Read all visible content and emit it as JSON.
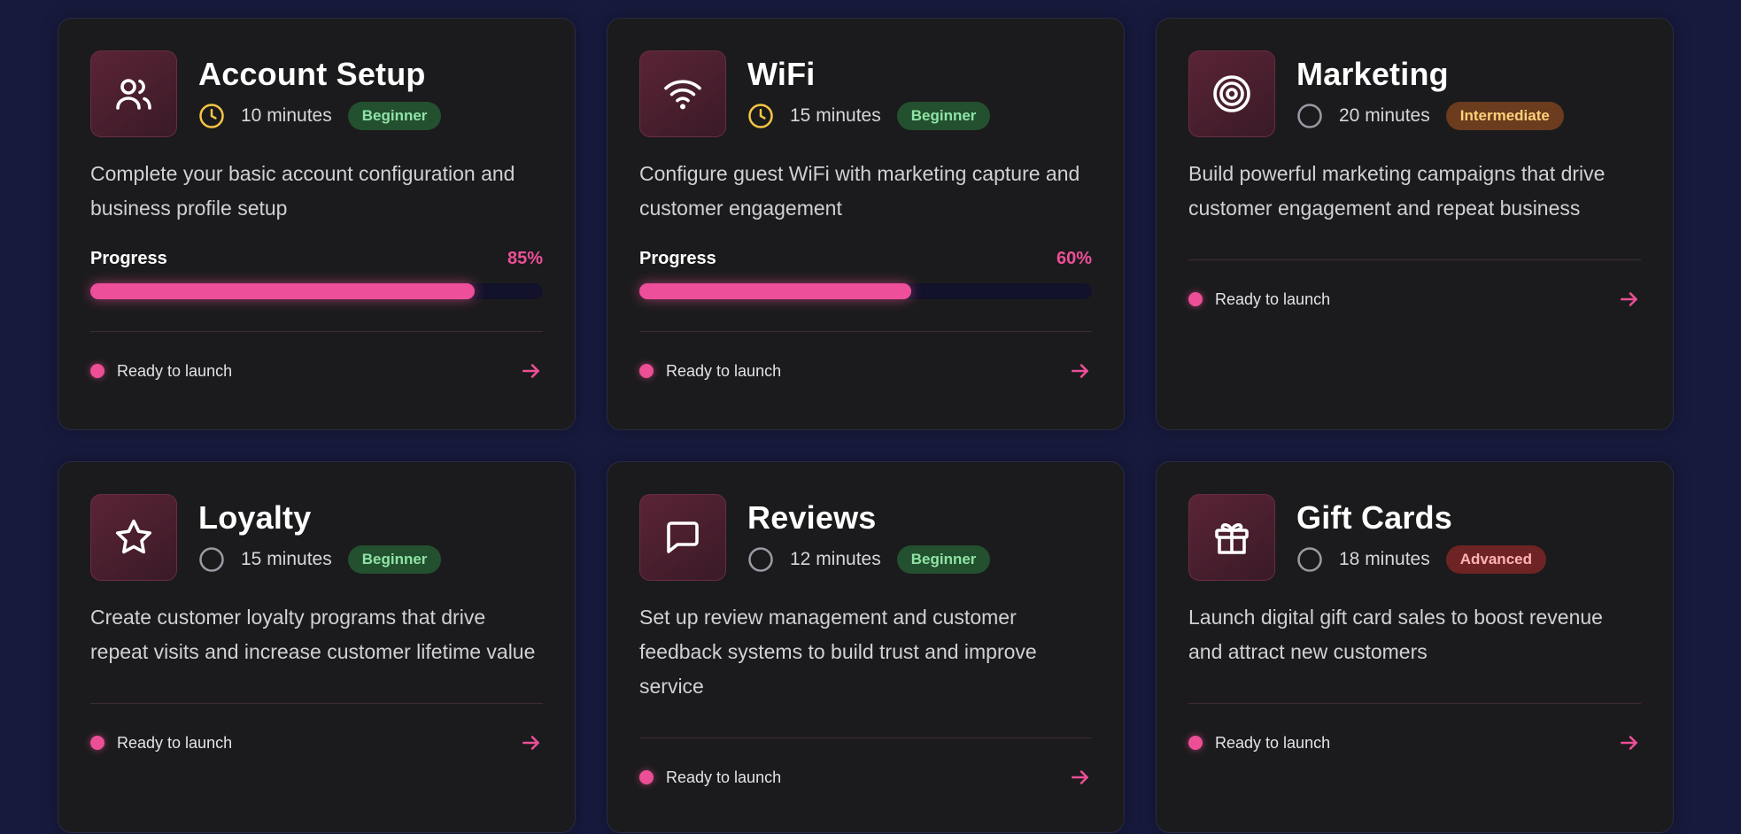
{
  "colors": {
    "page_bg": "#171a3d",
    "card_bg": "#1b1b1d",
    "accent": "#ec4f96",
    "clock_active": "#f5c542",
    "clock_idle": "#9a9aa4"
  },
  "cards": [
    {
      "title": "Account Setup",
      "icon": "users-icon",
      "clock": "active",
      "duration": "10 minutes",
      "level": "Beginner",
      "level_type": "beginner",
      "description": "Complete your basic account configuration and business profile setup",
      "progress_label": "Progress",
      "progress_value": 85,
      "progress_text": "85%",
      "status": "Ready to launch"
    },
    {
      "title": "WiFi",
      "icon": "wifi-icon",
      "clock": "active",
      "duration": "15 minutes",
      "level": "Beginner",
      "level_type": "beginner",
      "description": "Configure guest WiFi with marketing capture and customer engagement",
      "progress_label": "Progress",
      "progress_value": 60,
      "progress_text": "60%",
      "status": "Ready to launch"
    },
    {
      "title": "Marketing",
      "icon": "target-icon",
      "clock": "idle",
      "duration": "20 minutes",
      "level": "Intermediate",
      "level_type": "intermediate",
      "description": "Build powerful marketing campaigns that drive customer engagement and repeat business",
      "status": "Ready to launch"
    },
    {
      "title": "Loyalty",
      "icon": "star-icon",
      "clock": "idle",
      "duration": "15 minutes",
      "level": "Beginner",
      "level_type": "beginner",
      "description": "Create customer loyalty programs that drive repeat visits and increase customer lifetime value",
      "status": "Ready to launch"
    },
    {
      "title": "Reviews",
      "icon": "message-square-icon",
      "clock": "idle",
      "duration": "12 minutes",
      "level": "Beginner",
      "level_type": "beginner",
      "description": "Set up review management and customer feedback systems to build trust and improve service",
      "status": "Ready to launch"
    },
    {
      "title": "Gift Cards",
      "icon": "gift-icon",
      "clock": "idle",
      "duration": "18 minutes",
      "level": "Advanced",
      "level_type": "advanced",
      "description": "Launch digital gift card sales to boost revenue and attract new customers",
      "status": "Ready to launch"
    }
  ]
}
